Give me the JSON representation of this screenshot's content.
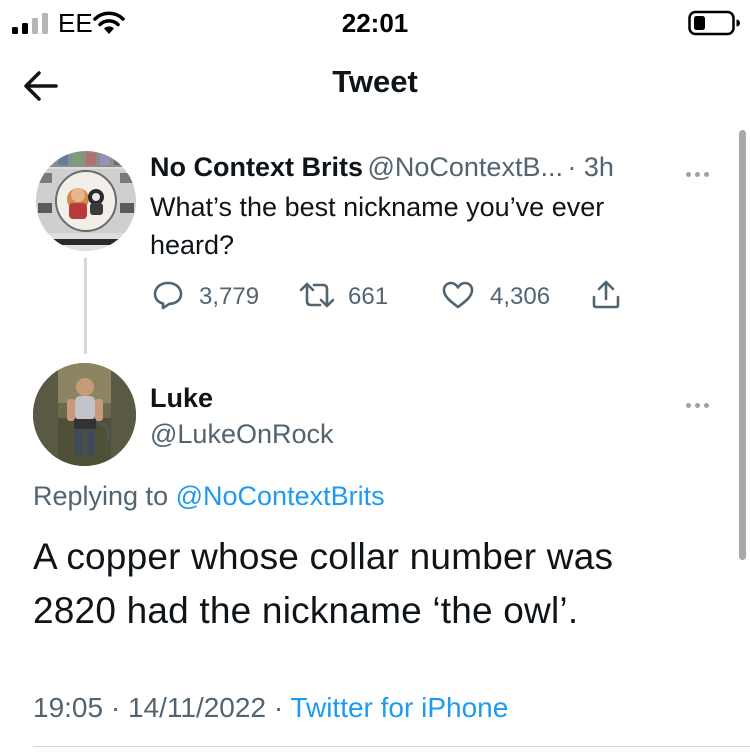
{
  "status_bar": {
    "carrier": "EE",
    "time": "22:01"
  },
  "header": {
    "title": "Tweet"
  },
  "parent_tweet": {
    "author_name": "No Context Brits",
    "author_handle": "@NoContextB...",
    "time_ago": "· 3h",
    "text_line1": "What’s the best nickname you’ve ever",
    "text_line2": "heard?",
    "replies": "3,779",
    "retweets": "661",
    "likes": "4,306"
  },
  "main_tweet": {
    "author_name": "Luke",
    "author_handle": "@LukeOnRock",
    "replying_prefix": "Replying to",
    "replying_handle": "@NoContextBrits",
    "text_line1": "A copper whose collar number was",
    "text_line2": "2820 had the nickname ‘the owl’.",
    "time": "19:05",
    "date": "14/11/2022",
    "source": "Twitter for iPhone"
  }
}
